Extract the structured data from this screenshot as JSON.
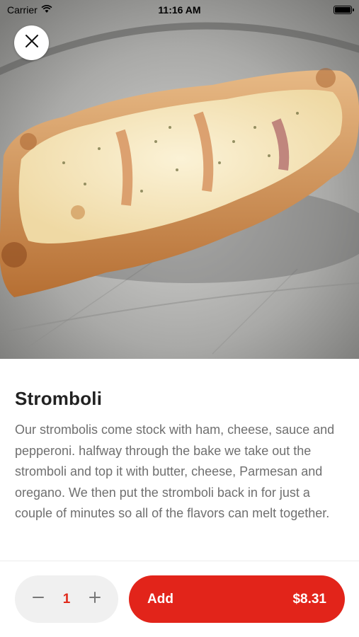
{
  "status_bar": {
    "carrier": "Carrier",
    "time": "11:16 AM"
  },
  "product": {
    "name": "Stromboli",
    "description": "Our strombolis come stock with ham, cheese, sauce and pepperoni. halfway through the bake we take out the stromboli and top it with butter, cheese, Parmesan and oregano. We then put the stromboli back in for just a couple of minutes so all of the flavors can melt together."
  },
  "order": {
    "quantity": "1",
    "add_label": "Add",
    "price": "$8.31"
  },
  "icons": {
    "close": "close-icon",
    "minus": "minus-icon",
    "plus": "plus-icon",
    "wifi": "wifi-icon",
    "battery": "battery-icon"
  },
  "colors": {
    "accent": "#e2241a",
    "quantity_text": "#e02a1b",
    "title_text": "#222222",
    "body_text": "#6f6f6f"
  }
}
